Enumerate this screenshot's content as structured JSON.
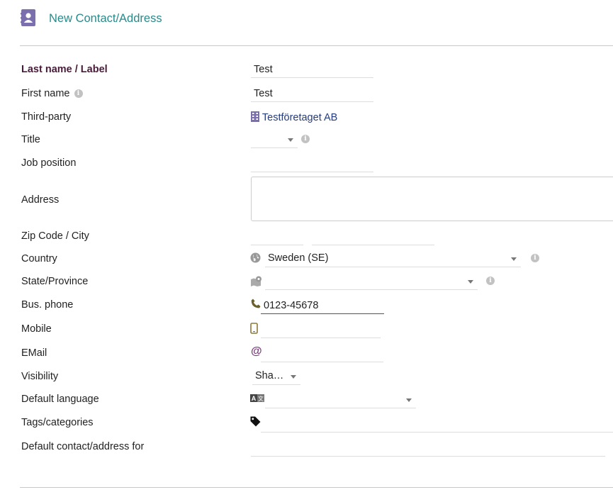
{
  "header": {
    "title": "New Contact/Address",
    "icon": "contact-card-icon"
  },
  "colors": {
    "accent": "#2a8a8a",
    "required_label": "#4a1a3a",
    "icon_purple": "#7c6fae",
    "link": "#263c7c"
  },
  "form": {
    "lastname": {
      "label": "Last name / Label",
      "value": "Test"
    },
    "firstname": {
      "label": "First name",
      "value": "Test"
    },
    "thirdparty": {
      "label": "Third-party",
      "value": "Testföretaget AB"
    },
    "title": {
      "label": "Title",
      "value": ""
    },
    "job_position": {
      "label": "Job position",
      "value": ""
    },
    "address": {
      "label": "Address",
      "value": ""
    },
    "zip_city": {
      "label": "Zip Code / City",
      "zip": "",
      "city": ""
    },
    "country": {
      "label": "Country",
      "value": "Sweden (SE)"
    },
    "state": {
      "label": "State/Province",
      "value": ""
    },
    "bus_phone": {
      "label": "Bus. phone",
      "value": "0123-45678"
    },
    "mobile": {
      "label": "Mobile",
      "value": ""
    },
    "email": {
      "label": "EMail",
      "value": ""
    },
    "visibility": {
      "label": "Visibility",
      "value": "Sha…"
    },
    "default_language": {
      "label": "Default language",
      "value": ""
    },
    "tags": {
      "label": "Tags/categories",
      "value": ""
    },
    "default_contact_for": {
      "label": "Default contact/address for",
      "value": ""
    }
  }
}
